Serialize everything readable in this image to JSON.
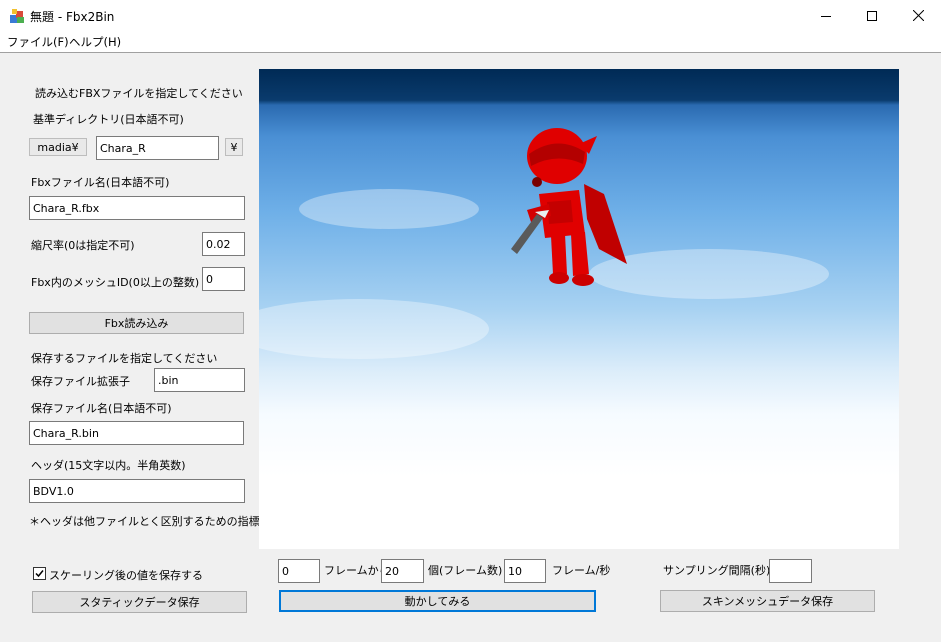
{
  "window": {
    "title": "無題 - Fbx2Bin"
  },
  "menu": [
    {
      "label": "ファイル(F)"
    },
    {
      "label": "ヘルプ(H)"
    }
  ],
  "left_panel": {
    "prompt": "読み込むFBXファイルを指定してください",
    "base_dir_label": "基準ディレクトリ(日本語不可)",
    "base_dir_prefix": "madia¥",
    "base_dir_value": "Chara_R",
    "base_dir_suffix": "¥",
    "fbx_name_label": "Fbxファイル名(日本語不可)",
    "fbx_name_value": "Chara_R.fbx",
    "scale_label": "縮尺率(0は指定不可)",
    "scale_value": "0.02",
    "mesh_id_label": "Fbx内のメッシュID(0以上の整数)",
    "mesh_id_value": "0",
    "load_button": "Fbx読み込み",
    "save_prompt": "保存するファイルを指定してください",
    "ext_label": "保存ファイル拡張子",
    "ext_value": ".bin",
    "save_name_label": "保存ファイル名(日本語不可)",
    "save_name_value": "Chara_R.bin",
    "header_label": "ヘッダ(15文字以内。半角英数)",
    "header_value": "BDV1.0",
    "note": "＊ヘッダは他ファイルとく区別するための指標です"
  },
  "bottom": {
    "checkbox_label": "スケーリング後の値を保存する",
    "checkbox_checked": true,
    "static_save_button": "スタティックデータ保存",
    "frame_from_value": "0",
    "frame_from_label": "フレームから",
    "frame_count_value": "20",
    "frame_count_label": "個(フレーム数)",
    "fps_value": "10",
    "fps_label": "フレーム/秒",
    "play_button": "動かしてみる",
    "sampling_label": "サンプリング間隔(秒)",
    "sampling_value": "",
    "skin_save_button": "スキンメッシュデータ保存"
  },
  "colors": {
    "accent": "#0078d7",
    "panel_bg": "#f0f0f0",
    "model_red": "#e00000"
  },
  "icons": [
    "app-icon",
    "minimize-icon",
    "maximize-icon",
    "close-icon",
    "checkmark-icon"
  ]
}
